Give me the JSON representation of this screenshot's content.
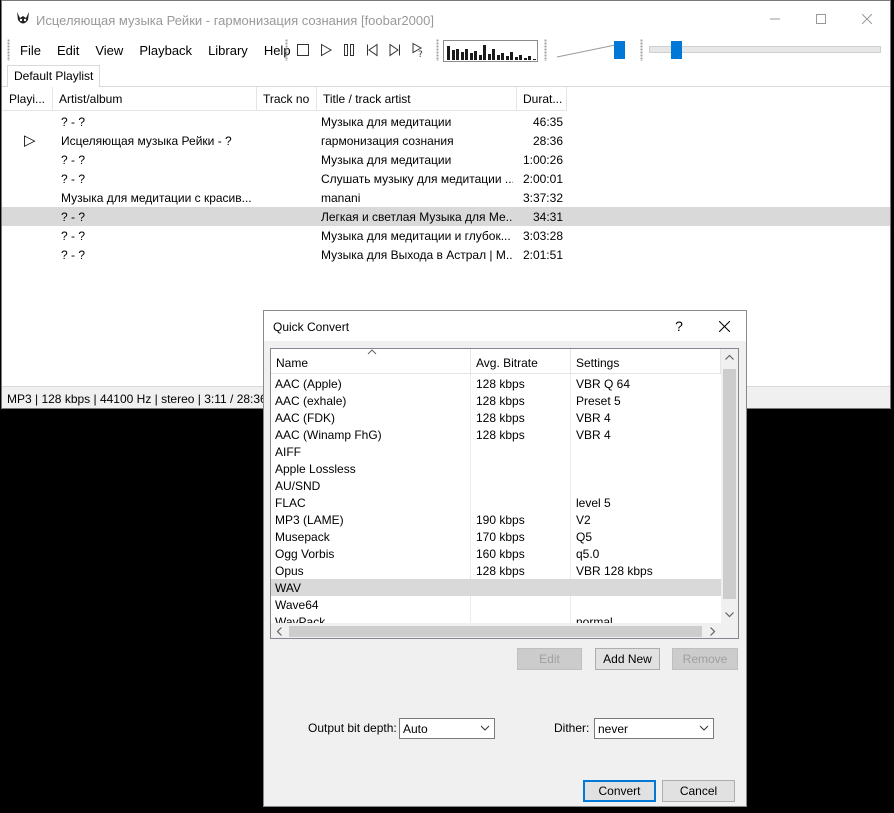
{
  "window": {
    "title": "Исцеляющая музыка Рейки - гармонизация сознания  [foobar2000]"
  },
  "menu": [
    "File",
    "Edit",
    "View",
    "Playback",
    "Library",
    "Help"
  ],
  "volume_level": 0.88,
  "seek_position": 0.1,
  "visualizer_levels": [
    0.8,
    0.55,
    0.6,
    0.45,
    0.6,
    0.4,
    0.5,
    0.3,
    0.85,
    0.35,
    0.6,
    0.25,
    0.4,
    0.2,
    0.45,
    0.15,
    0.3,
    0.1,
    0.2,
    0.08
  ],
  "tabs": [
    "Default Playlist"
  ],
  "playlist": {
    "columns": [
      "Playi...",
      "Artist/album",
      "Track no",
      "Title / track artist",
      "Durat..."
    ],
    "rows": [
      {
        "playing": "",
        "artist": "? - ?",
        "track": "",
        "title": "Музыка для медитации",
        "duration": "46:35"
      },
      {
        "playing": "▷",
        "artist": "Исцеляющая музыка Рейки - ?",
        "track": "",
        "title": "гармонизация сознания",
        "duration": "28:36"
      },
      {
        "playing": "",
        "artist": "? - ?",
        "track": "",
        "title": "Музыка для медитации",
        "duration": "1:00:26"
      },
      {
        "playing": "",
        "artist": "? - ?",
        "track": "",
        "title": "Слушать музыку для медитации ...",
        "duration": "2:00:01"
      },
      {
        "playing": "",
        "artist": "Музыка для медитации с красив...",
        "track": "",
        "title": "manani",
        "duration": "3:37:32"
      },
      {
        "playing": "",
        "artist": "? - ?",
        "track": "",
        "title": "Легкая и светлая Музыка для Ме...",
        "duration": "34:31"
      },
      {
        "playing": "",
        "artist": "? - ?",
        "track": "",
        "title": "Музыка для медитации и глубок...",
        "duration": "3:03:28"
      },
      {
        "playing": "",
        "artist": "? - ?",
        "track": "",
        "title": "Музыка для Выхода в Астрал | М...",
        "duration": "2:01:51"
      }
    ]
  },
  "status": "MP3 | 128 kbps | 44100 Hz | stereo | 3:11 / 28:36",
  "dialog": {
    "title": "Quick Convert",
    "help": "?",
    "columns": [
      "Name",
      "Avg. Bitrate",
      "Settings"
    ],
    "presets": [
      {
        "name": "AAC (Apple)",
        "bitrate": "128 kbps",
        "settings": "VBR Q 64"
      },
      {
        "name": "AAC (exhale)",
        "bitrate": "128 kbps",
        "settings": "Preset 5"
      },
      {
        "name": "AAC (FDK)",
        "bitrate": "128 kbps",
        "settings": "VBR 4"
      },
      {
        "name": "AAC (Winamp FhG)",
        "bitrate": "128 kbps",
        "settings": "VBR 4"
      },
      {
        "name": "AIFF",
        "bitrate": "",
        "settings": ""
      },
      {
        "name": "Apple Lossless",
        "bitrate": "",
        "settings": ""
      },
      {
        "name": "AU/SND",
        "bitrate": "",
        "settings": ""
      },
      {
        "name": "FLAC",
        "bitrate": "",
        "settings": "level 5"
      },
      {
        "name": "MP3 (LAME)",
        "bitrate": "190 kbps",
        "settings": "V2"
      },
      {
        "name": "Musepack",
        "bitrate": "170 kbps",
        "settings": "Q5"
      },
      {
        "name": "Ogg Vorbis",
        "bitrate": "160 kbps",
        "settings": "q5.0"
      },
      {
        "name": "Opus",
        "bitrate": "128 kbps",
        "settings": "VBR 128 kbps"
      },
      {
        "name": "WAV",
        "bitrate": "",
        "settings": ""
      },
      {
        "name": "Wave64",
        "bitrate": "",
        "settings": ""
      },
      {
        "name": "WavPack",
        "bitrate": "",
        "settings": "normal"
      }
    ],
    "buttons": {
      "edit": "Edit",
      "add_new": "Add New",
      "remove": "Remove",
      "convert": "Convert",
      "cancel": "Cancel"
    },
    "bit_depth_label": "Output bit depth:",
    "bit_depth_value": "Auto",
    "dither_label": "Dither:",
    "dither_value": "never"
  }
}
